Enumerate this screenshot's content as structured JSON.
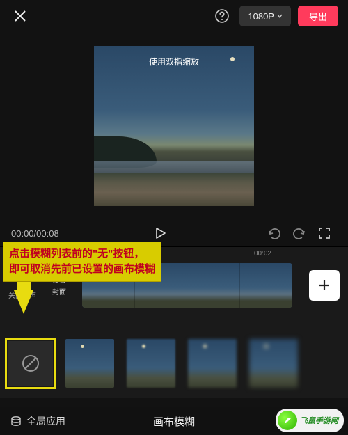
{
  "topbar": {
    "resolution_label": "1080P",
    "export_label": "导出"
  },
  "preview": {
    "hint": "使用双指缩放"
  },
  "controls": {
    "current_time": "00:00",
    "total_time": "00:08"
  },
  "timeline": {
    "ruler_mark": "00:02",
    "mute": {
      "line1": "关闭原声"
    },
    "cover": {
      "line1": "设置",
      "line2": "封面"
    },
    "add_label": "+"
  },
  "callout": {
    "line1": "点击模糊列表前的\"无\"按钮，",
    "line2": "即可取消先前已设置的画布模糊"
  },
  "bottom": {
    "apply_global": "全局应用",
    "title": "画布模糊"
  },
  "watermark": {
    "brand": "飞鼠手游网"
  }
}
